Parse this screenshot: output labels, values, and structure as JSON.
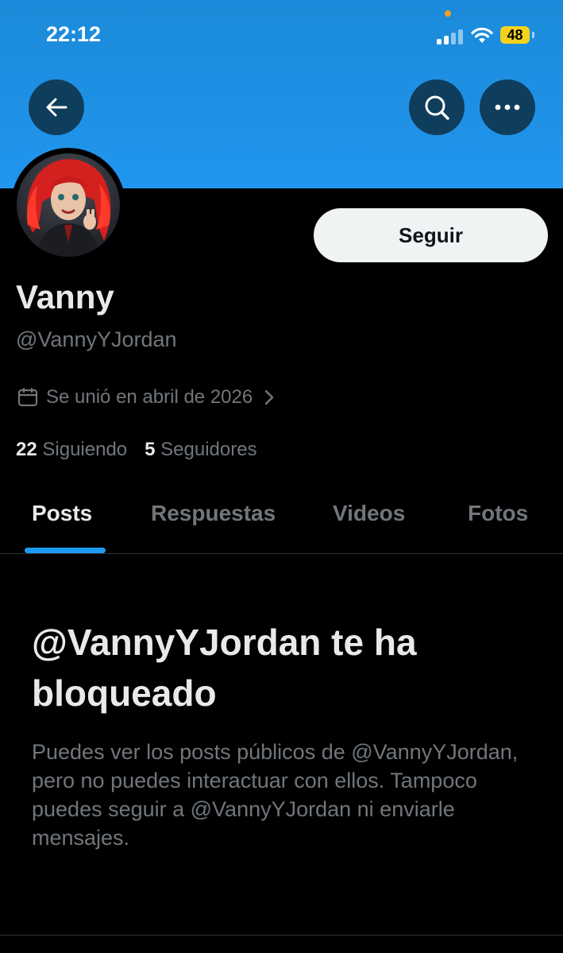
{
  "status_bar": {
    "time": "22:12",
    "battery": "48"
  },
  "profile": {
    "name": "Vanny",
    "handle": "@VannyYJordan",
    "joined": "Se unió en abril de 2026",
    "following_count": "22",
    "following_label": "Siguiendo",
    "followers_count": "5",
    "followers_label": "Seguidores",
    "follow_button": "Seguir"
  },
  "tabs": [
    {
      "label": "Posts",
      "active": true
    },
    {
      "label": "Respuestas",
      "active": false
    },
    {
      "label": "Videos",
      "active": false
    },
    {
      "label": "Fotos",
      "active": false
    }
  ],
  "blocked": {
    "title": "@VannyYJordan te ha bloqueado",
    "description": "Puedes ver los posts públicos de @VannyYJordan, pero no puedes interactuar con ellos. Tampoco puedes seguir a @VannyYJordan ni enviarle mensajes."
  },
  "icons": {
    "back": "back-arrow-icon",
    "search": "search-icon",
    "more": "more-options-icon",
    "calendar": "calendar-icon",
    "chevron": "chevron-right-icon"
  },
  "colors": {
    "banner": "#1b8ad9",
    "accent": "#1d9bf0",
    "muted_text": "#71767b",
    "battery": "#f4d21c"
  }
}
